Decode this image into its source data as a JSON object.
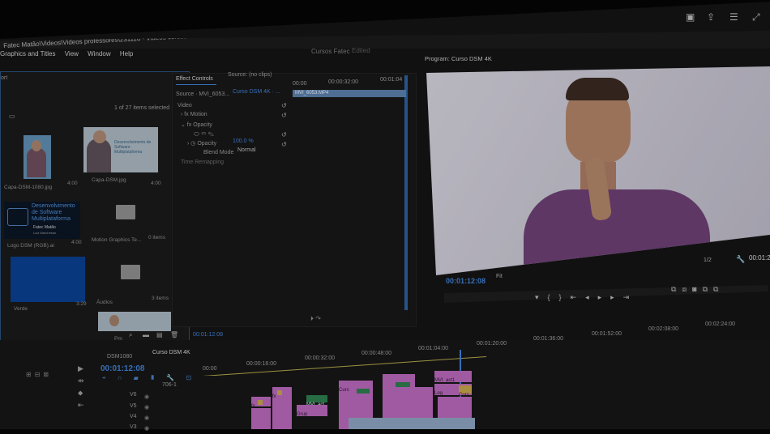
{
  "window": {
    "title": "Fatec Matão\\Videos\\Videos professores\\231110 - Videos cursos Fatec Matão\\Cursos Fatec\\Cursos Fatec.prproj *"
  },
  "menu": [
    "Graphics and Titles",
    "View",
    "Window",
    "Help"
  ],
  "workspace": {
    "name": "Cursos Fatec",
    "status": "Edited"
  },
  "project_panel": {
    "tab": "ort",
    "count": "1 of 27 items selected",
    "items": [
      {
        "name": "Capa-DSM-1080.jpg",
        "meta": "4:00"
      },
      {
        "name": "Capa-DSM.jpg",
        "meta": "4:00"
      },
      {
        "name": "Logo DSM (RGB).ai",
        "meta": "4:00"
      },
      {
        "name": "Motion Graphics Te...",
        "meta": "0 items"
      },
      {
        "name": "Verde",
        "meta": "3:29"
      },
      {
        "name": "Áudios",
        "meta": "3 items"
      }
    ],
    "thumb_text": {
      "capa": "Desenvolvimento de Software Multiplataforma",
      "logo_line1": "Desenvolvimento",
      "logo_line2": "de Software",
      "logo_line3": "Multiplataforma",
      "logo_org": "Fatec Matão",
      "logo_sub": "Luiz Marchesan"
    },
    "bottom_tc": "00:01:12:08",
    "zoom_label": "Pm"
  },
  "effect_controls": {
    "tab": "Effect Controls",
    "tab2": "Source: (no clips)",
    "source": "Source · MVI_6053...",
    "sequence": "Curso DSM 4K · ...",
    "section": "Video",
    "rows": [
      "Motion",
      "Opacity",
      "Opacity",
      "Blend Mode",
      "Time Remapping"
    ],
    "opacity_value": "100.0 %",
    "blend_value": "Normal",
    "ruler": [
      "00:00",
      "00:00:32:00",
      "00:01:04"
    ],
    "clip": "MVI_6053.MP4"
  },
  "program": {
    "title": "Program: Curso DSM 4K",
    "timecode": "00:01:12:08",
    "fit": "Fit",
    "res": "1/2",
    "duration": "00:01:2"
  },
  "timeline": {
    "tabs": [
      "DSM1080",
      "Curso DSM 4K"
    ],
    "timecode": "00:01:12:08",
    "ruler": [
      "00:00",
      "00:00:16:00",
      "00:00:32:00",
      "00:00:48:00",
      "00:01:04:00",
      "00:01:20:00",
      "00:01:36:00",
      "00:01:52:00",
      "00:02:08:00",
      "00:02:24:00"
    ],
    "tracks": [
      "V6",
      "V5",
      "V4",
      "V3"
    ],
    "track_labels": [
      "706-1"
    ],
    "clips": [
      "fx",
      "fx",
      "Curs",
      "MVI_act",
      "Log",
      "Curs",
      "Grup"
    ],
    "mvi_label": "MVI_act1"
  },
  "colors": {
    "accent": "#3f7fd3",
    "clip_pink": "#b767b9",
    "clip_green": "#2d7b4d",
    "bg": "#141414"
  }
}
